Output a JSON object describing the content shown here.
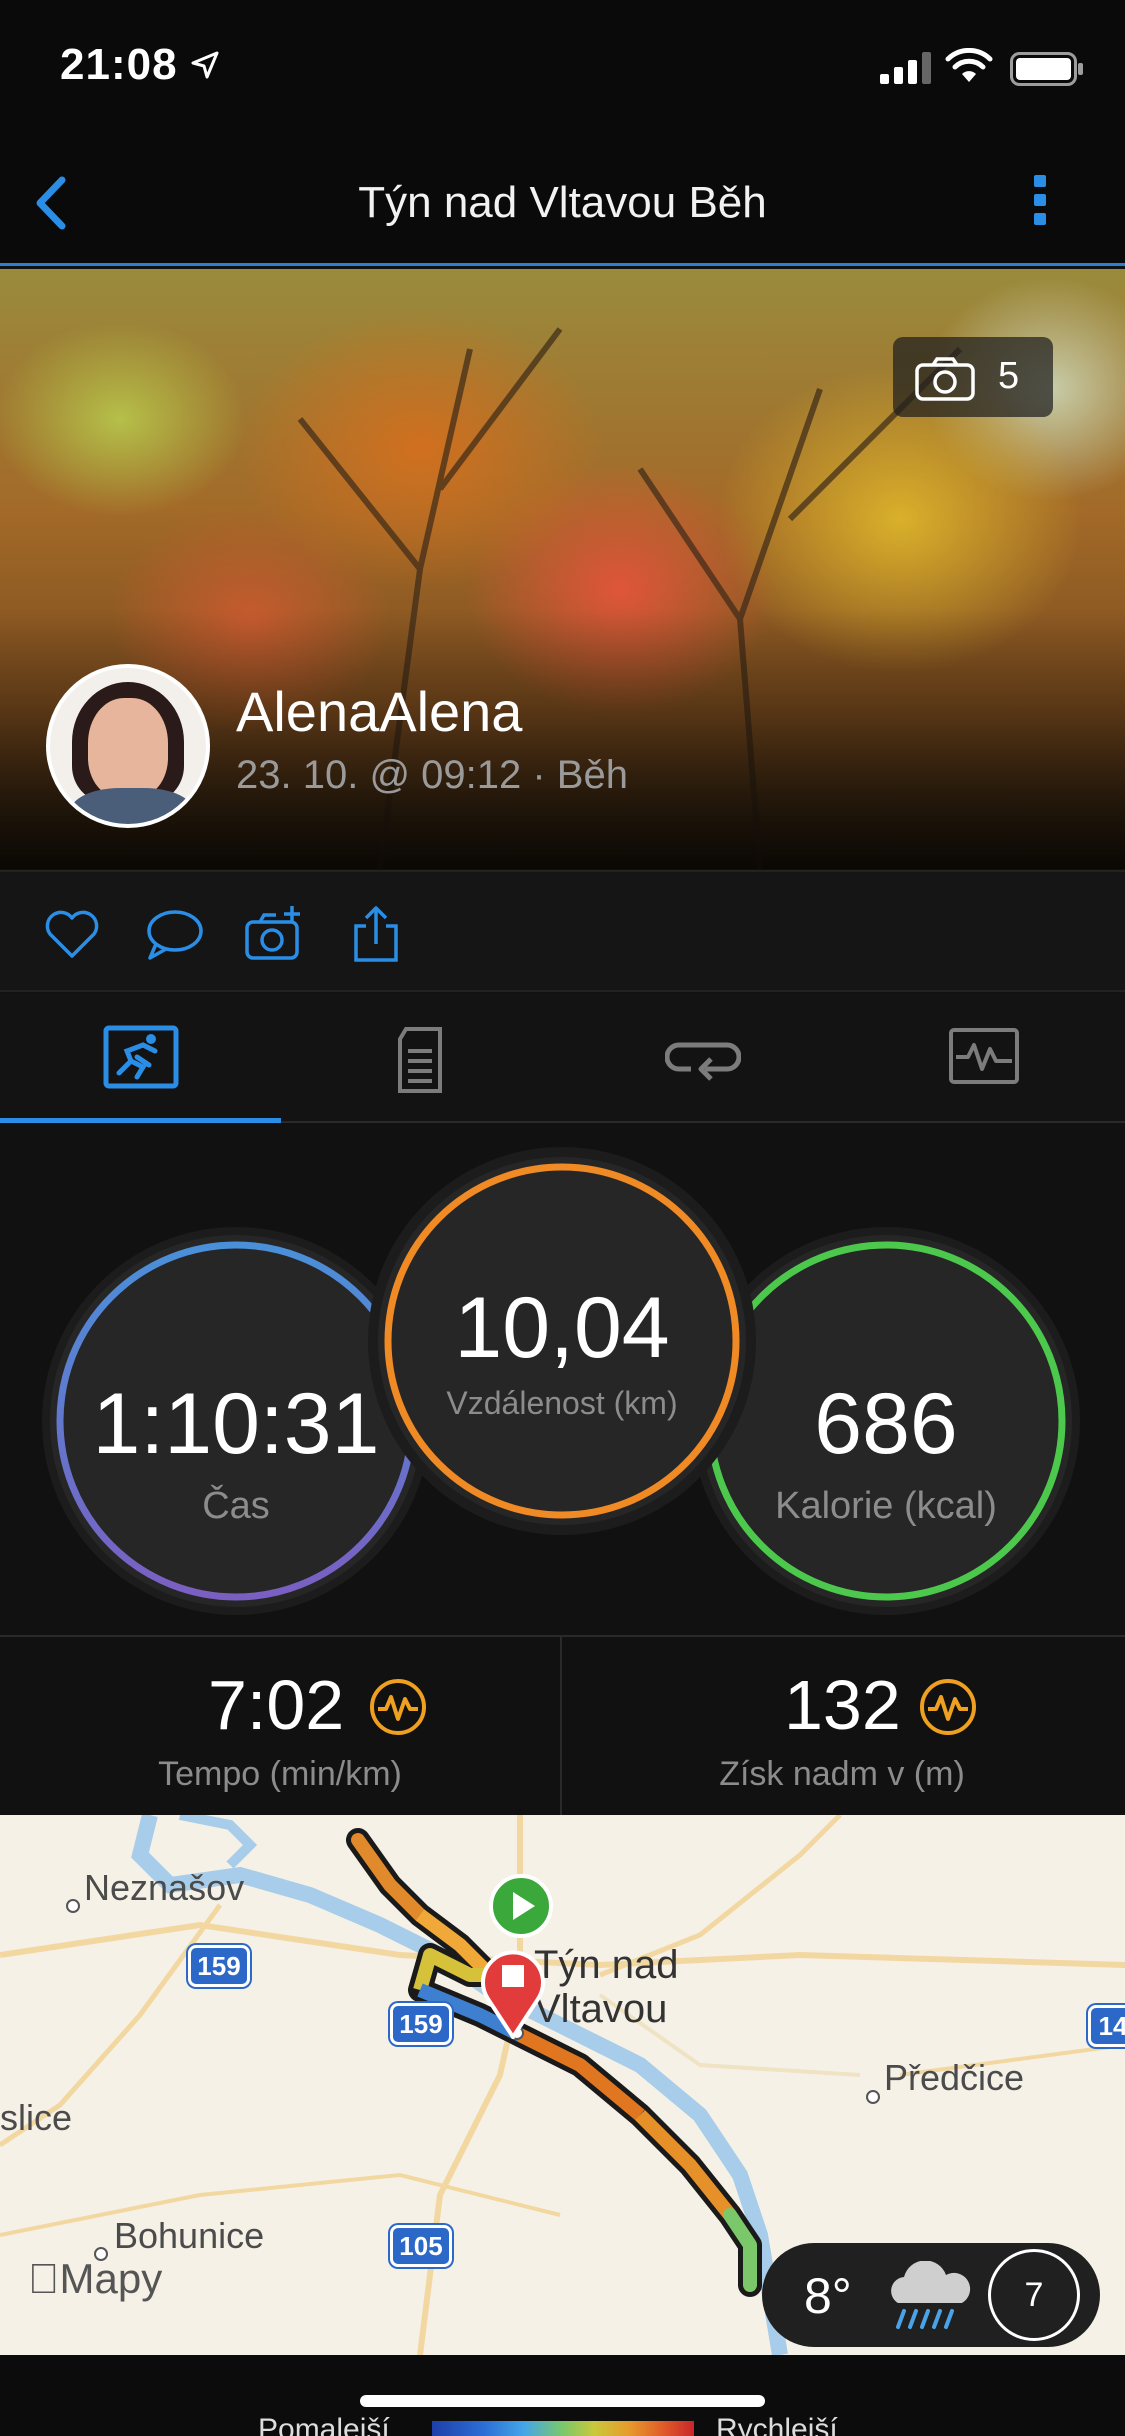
{
  "status_bar": {
    "time": "21:08"
  },
  "nav": {
    "title": "Týn nad Vltavou Běh"
  },
  "hero": {
    "photo_count": "5",
    "user_name": "AlenaAlena",
    "activity_meta": "23. 10. @ 09:12 · Běh"
  },
  "tabs": [
    {
      "name": "overview",
      "active": true
    },
    {
      "name": "details",
      "active": false
    },
    {
      "name": "laps",
      "active": false
    },
    {
      "name": "charts",
      "active": false
    }
  ],
  "stats": {
    "time": {
      "value": "1:10:31",
      "label": "Čas",
      "color_top": "#4a90d9",
      "color_bottom": "#7a5fc2"
    },
    "distance": {
      "value": "10,04",
      "label": "Vzdálenost (km)",
      "color": "#f08a24"
    },
    "calories": {
      "value": "686",
      "label": "Kalorie (kcal)",
      "color": "#4cc94c"
    }
  },
  "secondary": {
    "pace": {
      "value": "7:02",
      "label": "Tempo (min/km)"
    },
    "elevation": {
      "value": "132",
      "label": "Získ nadm v (m)"
    }
  },
  "map": {
    "places": {
      "neznasov": "Neznašov",
      "tyn": "Týn nad",
      "tyn2": "Vltavou",
      "predcice": "Předčice",
      "slice": "slice",
      "bohunice": "Bohunice"
    },
    "roads": {
      "r159a": "159",
      "r159b": "159",
      "r105": "105",
      "r14": "14"
    },
    "logo": "Mapy",
    "weather": {
      "temp": "8°",
      "wind": "7"
    }
  },
  "legend": {
    "slow": "Pomalejší",
    "fast": "Rychlejší"
  },
  "colors": {
    "accent": "#2b8ee6",
    "start": "#3aa83a",
    "stop": "#e23b3b"
  }
}
